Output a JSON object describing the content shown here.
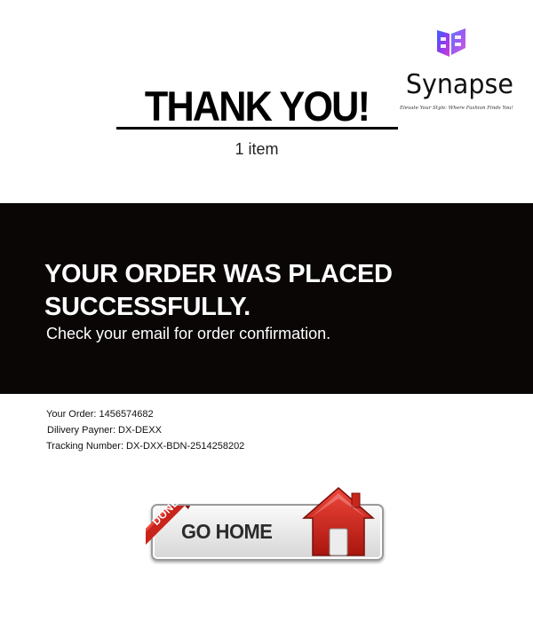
{
  "header": {
    "title": "THANK YOU!",
    "item_count": "1 item"
  },
  "logo": {
    "name": "Synapse",
    "tagline": "Elevate Your Style: Where Fashion Finds You!",
    "mark_icon": "synapse-logo-mark",
    "accent_colors": [
      "#6a3cf0",
      "#c640d8",
      "#3a64ff"
    ]
  },
  "banner": {
    "heading_line1": "YOUR ORDER WAS PLACED",
    "heading_line2": "SUCCESSFULLY.",
    "subtext": "Check your email for order confirmation.",
    "background": "#0a0606"
  },
  "order": {
    "order_label": "Your Order:",
    "order_value": "1456574682",
    "payner_label": "Dilivery Payner:",
    "payner_value": "DX-DEXX",
    "tracking_label": "Tracking Number:",
    "tracking_value": "DX-DXX-BDN-2514258202"
  },
  "button": {
    "label": "GO HOME",
    "ribbon": "DONE",
    "icon": "house-icon",
    "accent": "#d0281c"
  }
}
